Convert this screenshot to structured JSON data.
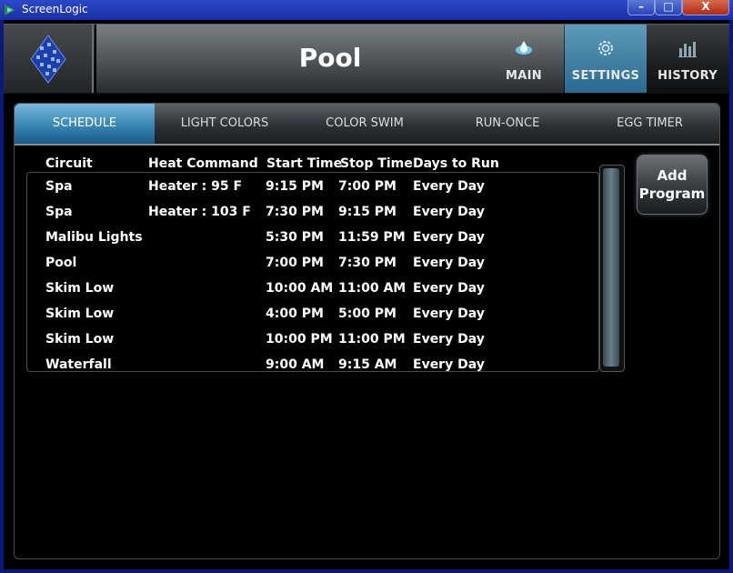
{
  "window": {
    "title": "ScreenLogic",
    "minimize": "–",
    "maximize": "□",
    "close": "X"
  },
  "header": {
    "title": "Pool"
  },
  "nav": [
    {
      "label": "MAIN",
      "icon": "pool-drop-icon"
    },
    {
      "label": "SETTINGS",
      "icon": "gear-icon"
    },
    {
      "label": "HISTORY",
      "icon": "bar-chart-icon"
    }
  ],
  "tabs": [
    "SCHEDULE",
    "LIGHT COLORS",
    "COLOR SWIM",
    "RUN-ONCE",
    "EGG TIMER"
  ],
  "active_tab": "SCHEDULE",
  "columns": [
    "Circuit",
    "Heat Command",
    "Start Time",
    "Stop Time",
    "Days to Run"
  ],
  "rows": [
    [
      "Spa",
      "Heater : 95 F",
      "9:15  PM",
      "7:00  PM",
      "Every Day"
    ],
    [
      "Spa",
      "Heater : 103 F",
      "7:30  PM",
      "9:15  PM",
      "Every Day"
    ],
    [
      "Malibu Lights",
      "",
      "5:30  PM",
      "11:59  PM",
      "Every Day"
    ],
    [
      "Pool",
      "",
      "7:00  PM",
      "7:30  PM",
      "Every Day"
    ],
    [
      "Skim Low",
      "",
      "10:00  AM",
      "11:00  AM",
      "Every Day"
    ],
    [
      "Skim Low",
      "",
      "4:00  PM",
      "5:00  PM",
      "Every Day"
    ],
    [
      "Skim Low",
      "",
      "10:00  PM",
      "11:00  PM",
      "Every Day"
    ],
    [
      "Waterfall",
      "",
      "9:00  AM",
      "9:15  AM",
      "Every Day"
    ]
  ],
  "add_button": {
    "line1": "Add",
    "line2": "Program"
  },
  "colors": {
    "accent": "#3c8ab8",
    "titlebar": "#1a2fa8",
    "background": "#000000"
  }
}
